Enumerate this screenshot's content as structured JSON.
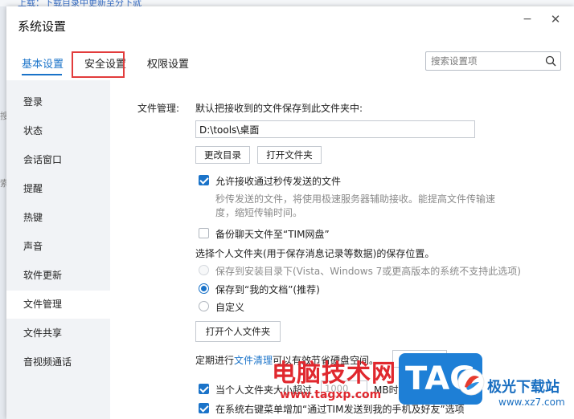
{
  "background": {
    "top_text": "上载：下载目录中更新至分下就",
    "left_marks": [
      "搜",
      "索"
    ]
  },
  "window": {
    "title": "系统设置",
    "minimize_symbol": "−",
    "close_symbol": "✕"
  },
  "tabs": [
    {
      "label": "基本设置",
      "active": true
    },
    {
      "label": "安全设置",
      "active": false
    },
    {
      "label": "权限设置",
      "active": false
    }
  ],
  "search": {
    "placeholder": "搜索设置项",
    "icon": "search-icon"
  },
  "sidebar": {
    "items": [
      {
        "label": "登录"
      },
      {
        "label": "状态"
      },
      {
        "label": "会话窗口"
      },
      {
        "label": "提醒"
      },
      {
        "label": "热键"
      },
      {
        "label": "声音"
      },
      {
        "label": "软件更新"
      },
      {
        "label": "文件管理"
      },
      {
        "label": "文件共享"
      },
      {
        "label": "音视频通话"
      }
    ],
    "active_index": 7
  },
  "file_management": {
    "section_label": "文件管理:",
    "save_desc": "默认把接收到的文件保存到此文件夹中:",
    "path_value": "D:\\tools\\桌面",
    "change_dir_btn": "更改目录",
    "open_folder_btn": "打开文件夹",
    "allow_fast_send": {
      "checked": true,
      "label": "允许接收通过秒传发送的文件"
    },
    "fast_send_desc_line1": "秒传发送的文件，将使用极速服务器辅助接收。能提高文件传输速",
    "fast_send_desc_line2": "度，缩短传输时间。",
    "backup_cloud": {
      "checked": false,
      "label": "备份聊天文件至“TIM网盘”"
    },
    "personal_folder_desc": "选择个人文件夹(用于保存消息记录等数据)的保存位置。",
    "radio_install_dir": {
      "selected": false,
      "disabled": true,
      "label": "保存到安装目录下(Vista、Windows 7或更高版本的系统不支持此选项)"
    },
    "radio_my_docs": {
      "selected": true,
      "disabled": false,
      "label": "保存到“我的文档”(推荐)"
    },
    "radio_custom": {
      "selected": false,
      "disabled": false,
      "label": "自定义"
    },
    "open_personal_btn": "打开个人文件夹",
    "cleanup_prefix": "定期进行",
    "cleanup_link": "文件清理",
    "cleanup_suffix": "可以有效节省硬盘空间。",
    "cleanup_btn": "前去清理",
    "size_limit": {
      "checked": true,
      "label": "当个人文件夹大小超过",
      "value": "1000",
      "unit": "MB时，提醒我清理"
    },
    "context_menu": {
      "checked": true,
      "label": "在系统右键菜单增加“通过TIM发送到我的手机及好友”选项"
    }
  },
  "watermarks": {
    "site_cn": "电脑技术网",
    "site_url": "www.tagxp.com",
    "tag_logo": "TAG",
    "right_brand": "极光下载站",
    "right_url": "www.xz7.com"
  },
  "colors": {
    "accent": "#1a73c9",
    "highlight_box": "#e23c3c",
    "watermark_red": "#e0282e"
  }
}
